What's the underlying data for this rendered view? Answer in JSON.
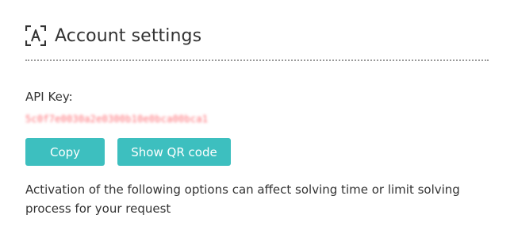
{
  "header": {
    "title": "Account settings",
    "icon": "text-recognition-icon"
  },
  "api": {
    "label": "API Key:",
    "value": "5c0f7e0030a2e0300b10e0bca00bca1"
  },
  "buttons": {
    "copy_label": "Copy",
    "qr_label": "Show QR code"
  },
  "notice": {
    "text": "Activation of the following options can affect solving time or limit solving process for your request"
  },
  "colors": {
    "accent": "#3dbfbf",
    "key_blur": "#ff6b72",
    "text": "#333333"
  }
}
